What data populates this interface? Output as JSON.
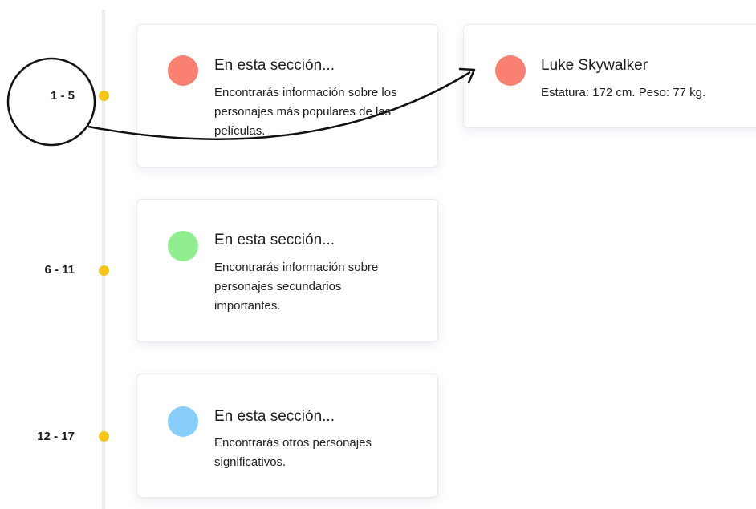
{
  "timeline": {
    "groups": [
      {
        "range": "1 - 5"
      },
      {
        "range": "6 - 11"
      },
      {
        "range": "12 - 17"
      }
    ]
  },
  "sections": [
    {
      "title": "En esta sección...",
      "text": "Encontrarás información sobre los personajes más populares de las películas.",
      "icon_color": "#fa8072"
    },
    {
      "title": "En esta sección...",
      "text": "Encontrarás información sobre personajes secundarios importantes.",
      "icon_color": "#90ee90"
    },
    {
      "title": "En esta sección...",
      "text": "Encontrarás otros personajes significativos.",
      "icon_color": "#87cefa"
    }
  ],
  "detail_card": {
    "name": "Luke Skywalker",
    "info": "Estatura: 172 cm. Peso: 77 kg.",
    "icon_color": "#fa8072"
  },
  "colors": {
    "timeline_dot": "#f5c518",
    "timeline_line": "#ececee"
  }
}
